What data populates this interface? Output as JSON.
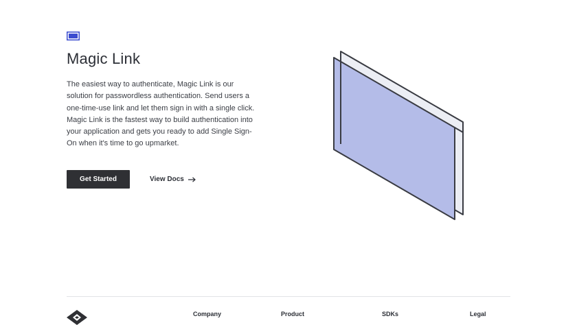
{
  "hero": {
    "title": "Magic Link",
    "description": "The easiest way to authenticate, Magic Link is our solution for passwordless authentication. Send users a one-time-use link and let them sign in with a single click. Magic Link is the fastest way to build authentication into your application and gets you ready to add Single Sign-On when it's time to go upmarket.",
    "primary_button": "Get Started",
    "secondary_link": "View Docs"
  },
  "footer": {
    "columns": [
      "Company",
      "Product",
      "SDKs",
      "Legal"
    ]
  },
  "colors": {
    "accent": "#3b4ccf",
    "illustration_fill": "#b4bce8",
    "button_bg": "#2f3034"
  },
  "icons": {
    "badge": "window-badge-icon",
    "arrow": "arrow-right-icon",
    "logo": "diamond-logo-icon"
  }
}
